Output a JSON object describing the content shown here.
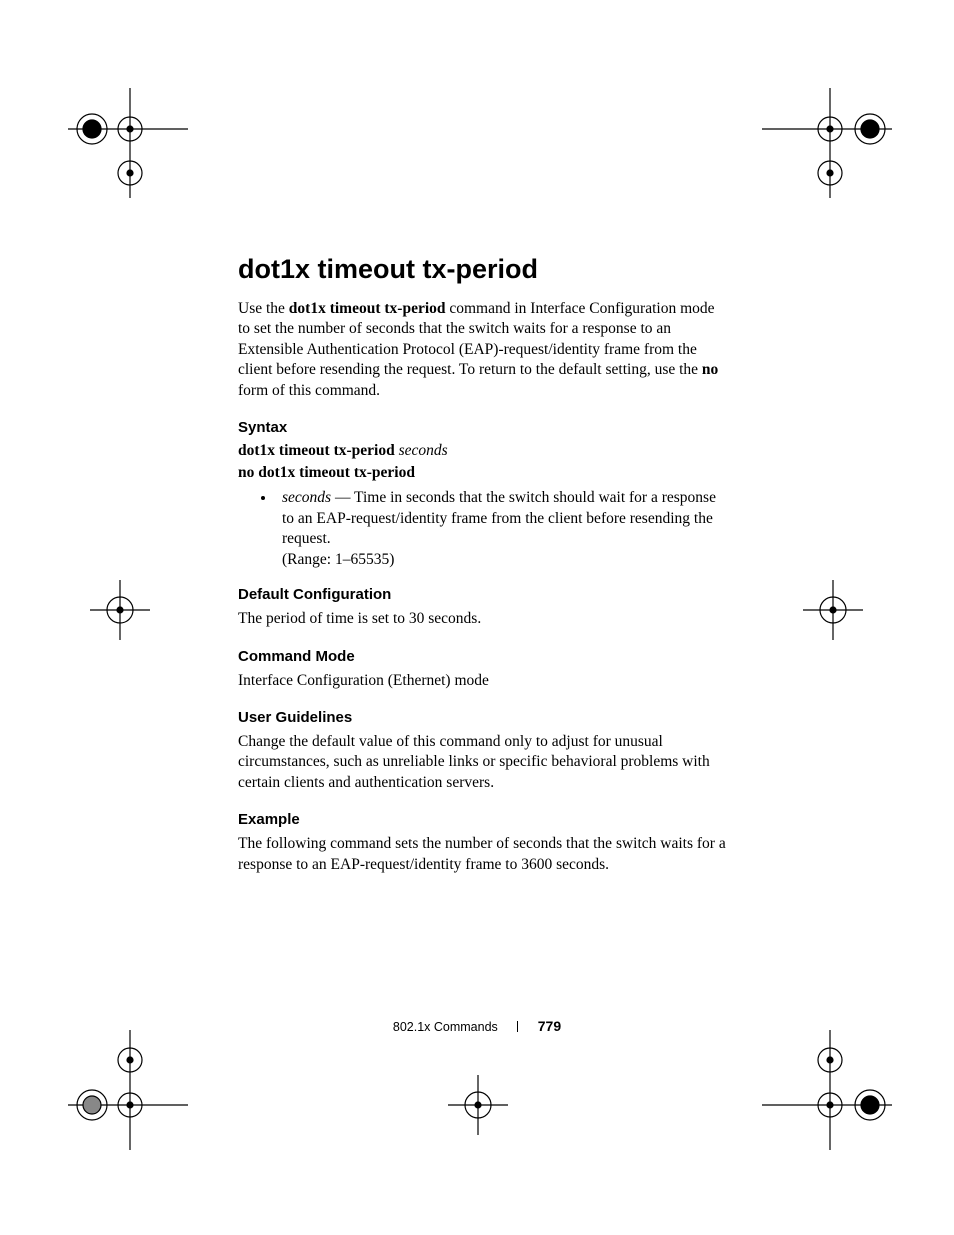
{
  "title": "dot1x timeout tx-period",
  "intro": {
    "pre": "Use the ",
    "cmd": "dot1x timeout tx-period",
    "post": " command in Interface Configuration mode to set the number of seconds that the switch waits for a response to an Extensible Authentication Protocol (EAP)-request/identity frame from the client before resending the request. To return to the default setting, use the ",
    "no": "no",
    "tail": " form of this command."
  },
  "sections": {
    "syntax": {
      "head": "Syntax",
      "line1_cmd": "dot1x timeout tx-period",
      "line1_arg": "seconds",
      "line2": "no dot1x timeout tx-period",
      "bullet_arg": "seconds",
      "bullet_text": " — Time in seconds that the switch should wait for a response to an EAP-request/identity frame from the client before resending the request.",
      "bullet_range": "(Range: 1–65535)"
    },
    "default": {
      "head": "Default Configuration",
      "text": "The period of time is set to 30 seconds."
    },
    "mode": {
      "head": "Command Mode",
      "text": "Interface Configuration (Ethernet) mode"
    },
    "guidelines": {
      "head": "User Guidelines",
      "text": "Change the default value of this command only to adjust for unusual circumstances, such as unreliable links or specific behavioral problems with certain clients and authentication servers."
    },
    "example": {
      "head": "Example",
      "text": "The following command sets the number of seconds that the switch waits for a response to an EAP-request/identity frame to 3600 seconds."
    }
  },
  "footer": {
    "chapter": "802.1x Commands",
    "page": "779"
  }
}
